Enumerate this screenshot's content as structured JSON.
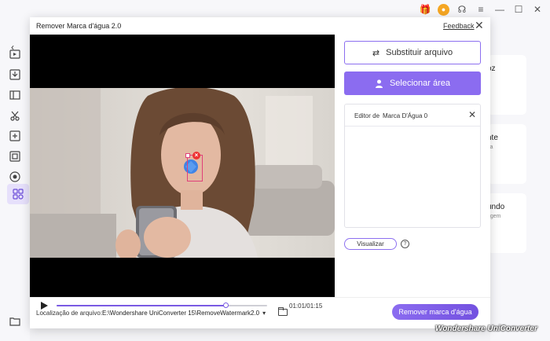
{
  "dialog": {
    "title": "Remover Marca d'água 2.0",
    "feedback": "Feedback"
  },
  "right_panel": {
    "replace_label": "Substituir arquivo",
    "select_label": "Selecionar área",
    "editor_label": "Editor de",
    "editor_name": "Marca D'Água 0",
    "preview_label": "Visualizar"
  },
  "player": {
    "time": "01:01/01:15",
    "progress": 0.803
  },
  "footer": {
    "location_label": "Localização de arquivo:",
    "location_value": "E:\\Wondershare UniConverter 15\\RemoveWatermark2.0",
    "remove_label": "Remover marca d'água"
  },
  "background_cards": [
    {
      "title": "oz",
      "sub": "a"
    },
    {
      "title": "nte",
      "sub": "ça"
    },
    {
      "title": "undo",
      "sub": "agem"
    }
  ],
  "brand": "Wondershare UniConverter",
  "colors": {
    "accent": "#8b6cf0",
    "delete": "#e33333"
  }
}
